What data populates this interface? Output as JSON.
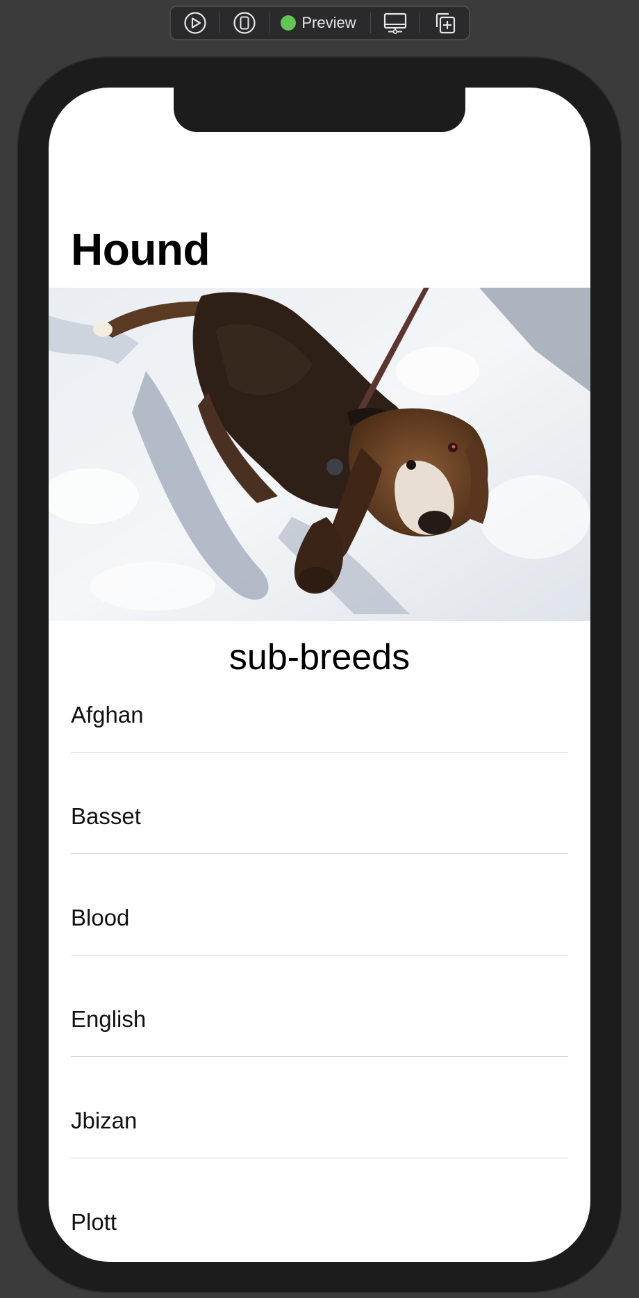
{
  "toolbar": {
    "preview_label": "Preview",
    "status_color": "#62c554",
    "icons": [
      "play-icon",
      "device-icon",
      "display-icon",
      "duplicate-icon"
    ]
  },
  "page": {
    "title": "Hound",
    "image_subject": "basset-hound-in-snow",
    "section_heading": "sub-breeds"
  },
  "subbreeds": [
    "Afghan",
    "Basset",
    "Blood",
    "English",
    "Jbizan",
    "Plott"
  ]
}
